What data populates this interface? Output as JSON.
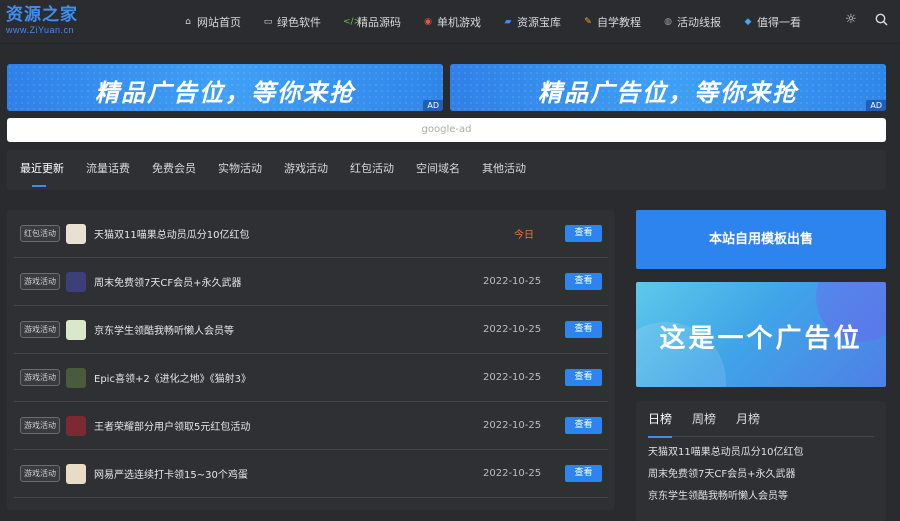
{
  "site": {
    "logo_main": "资源之家",
    "logo_sub": "www.ZiYuan.cn"
  },
  "nav": [
    {
      "label": "网站首页",
      "icon": "home-icon",
      "glyph": "⌂",
      "color": "#d8d8d8"
    },
    {
      "label": "绿色软件",
      "icon": "monitor-icon",
      "glyph": "▭",
      "color": "#d8d8d8"
    },
    {
      "label": "精品源码",
      "icon": "code-icon",
      "glyph": "</>",
      "color": "#6cc04a"
    },
    {
      "label": "单机游戏",
      "icon": "gamepad-icon",
      "glyph": "◉",
      "color": "#e9573f"
    },
    {
      "label": "资源宝库",
      "icon": "folder-icon",
      "glyph": "▰",
      "color": "#3b8eea"
    },
    {
      "label": "自学教程",
      "icon": "pencil-icon",
      "glyph": "✎",
      "color": "#f5a623"
    },
    {
      "label": "活动线报",
      "icon": "globe-icon",
      "glyph": "◍",
      "color": "#9a9a9a"
    },
    {
      "label": "值得一看",
      "icon": "diamond-icon",
      "glyph": "◆",
      "color": "#3fa9f5"
    }
  ],
  "ads": {
    "banner_text": "精品广告位，等你来抢",
    "banner_tag": "AD",
    "google_ad": "google-ad"
  },
  "tabs": [
    "最近更新",
    "流量话费",
    "免费会员",
    "实物活动",
    "游戏活动",
    "红包活动",
    "空间域名",
    "其他活动"
  ],
  "list": [
    {
      "badge": "红包活动",
      "title": "天猫双11喵果总动员瓜分10亿红包",
      "date": "今日",
      "today": true,
      "button": "查看",
      "thumb": "#e8e0d0"
    },
    {
      "badge": "游戏活动",
      "title": "周末免费领7天CF会员+永久武器",
      "date": "2022-10-25",
      "today": false,
      "button": "查看",
      "thumb": "#3c3f7a"
    },
    {
      "badge": "游戏活动",
      "title": "京东学生领酷我畅听懒人会员等",
      "date": "2022-10-25",
      "today": false,
      "button": "查看",
      "thumb": "#d9e8c8"
    },
    {
      "badge": "游戏活动",
      "title": "Epic喜领+2《进化之地》《猫射3》",
      "date": "2022-10-25",
      "today": false,
      "button": "查看",
      "thumb": "#4a5a3c"
    },
    {
      "badge": "游戏活动",
      "title": "王者荣耀部分用户领取5元红包活动",
      "date": "2022-10-25",
      "today": false,
      "button": "查看",
      "thumb": "#7a2a30"
    },
    {
      "badge": "游戏活动",
      "title": "网易严选连续打卡领15~30个鸡蛋",
      "date": "2022-10-25",
      "today": false,
      "button": "查看",
      "thumb": "#e9dcc4"
    }
  ],
  "sidebar": {
    "template_button": "本站自用模板出售",
    "ad_text": "这是一个广告位",
    "rank_tabs": [
      "日榜",
      "周榜",
      "月榜"
    ],
    "rank_items": [
      "天猫双11喵果总动员瓜分10亿红包",
      "周末免费领7天CF会员+永久武器",
      "京东学生领酷我畅听懒人会员等"
    ]
  }
}
